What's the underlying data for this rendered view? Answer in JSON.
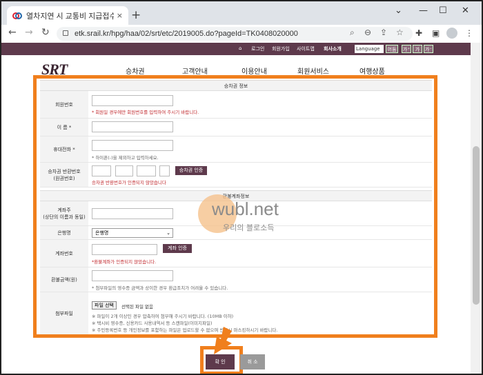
{
  "browser": {
    "tab_title": "열차지연 시 교통비 지급접수 | …",
    "tab_close": "×",
    "new_tab": "+",
    "url": "etk.srail.kr/hpg/haa/02/srt/etc/2019005.do?pageId=TK0408020000",
    "win_min": "⌄",
    "win_minimize": "—",
    "win_max": "☐",
    "win_close": "✕"
  },
  "sitebar": {
    "login": "로그인",
    "join": "회원가입",
    "sitemap": "사이트맵",
    "company": "회사소개",
    "language": "Language",
    "theme": "어둠",
    "font_plus": "가⁺",
    "font_normal": "가",
    "font_minus": "가⁻"
  },
  "site": {
    "logo": "SRT",
    "menu": [
      "승차권",
      "고객안내",
      "이용안내",
      "회원서비스",
      "여행상품"
    ]
  },
  "form": {
    "ticket_section": "승차권 정보",
    "member_label": "회원번호",
    "member_note": "* 회원일 경우에만 회원번호를 입력하여 주시기 바랍니다.",
    "name_label": "이 름 *",
    "phone_label": "휴대전화 *",
    "phone_note": "* 하이픈(-)을 제외하고 입력하세요.",
    "ticket_label": "승차권 반환번호\n(원권번호)",
    "ticket_btn": "승차권 인증",
    "ticket_note": "승차권 반환번호가 인증되지 않았습니다",
    "refund_section": "환불계좌정보",
    "holder_label": "계좌주\n(상단의 이름과 동일)",
    "bank_label": "은행명",
    "bank_value": "은행명",
    "account_label": "계좌번호",
    "account_btn": "계좌 인증",
    "account_note": "*환불계좌가 인증되지 않았습니다.",
    "amount_label": "환불금액(원)",
    "amount_note": "* 첨부파일의 영수증 금액과 상이한 경우 환급조치가 어려울 수 있습니다.",
    "file_label": "첨부파일",
    "file_btn": "파일 선택",
    "file_status": "선택된 파일 없음",
    "file_note1": "※ 파일이 2개 이상인 경우 압축하여 첨부해 주시기 바랍니다. (10MB 이하)",
    "file_note2": "※ 택시비 영수증, 신용카드 사용내역서 등 스캔파일(이미지파일)",
    "file_note3": "※ 주민등록번호 등 개인정보를 포함하는 파일은 업로드할 수 없으며 반드시 마스킹하시기 바랍니다."
  },
  "buttons": {
    "confirm": "확 인",
    "cancel": "취 소"
  },
  "watermark": {
    "main": "wubl.net",
    "sub": "우리의 블로소득"
  },
  "colors": {
    "brand": "#5e3a4c",
    "highlight": "#f07f1d",
    "error": "#c0282d"
  }
}
